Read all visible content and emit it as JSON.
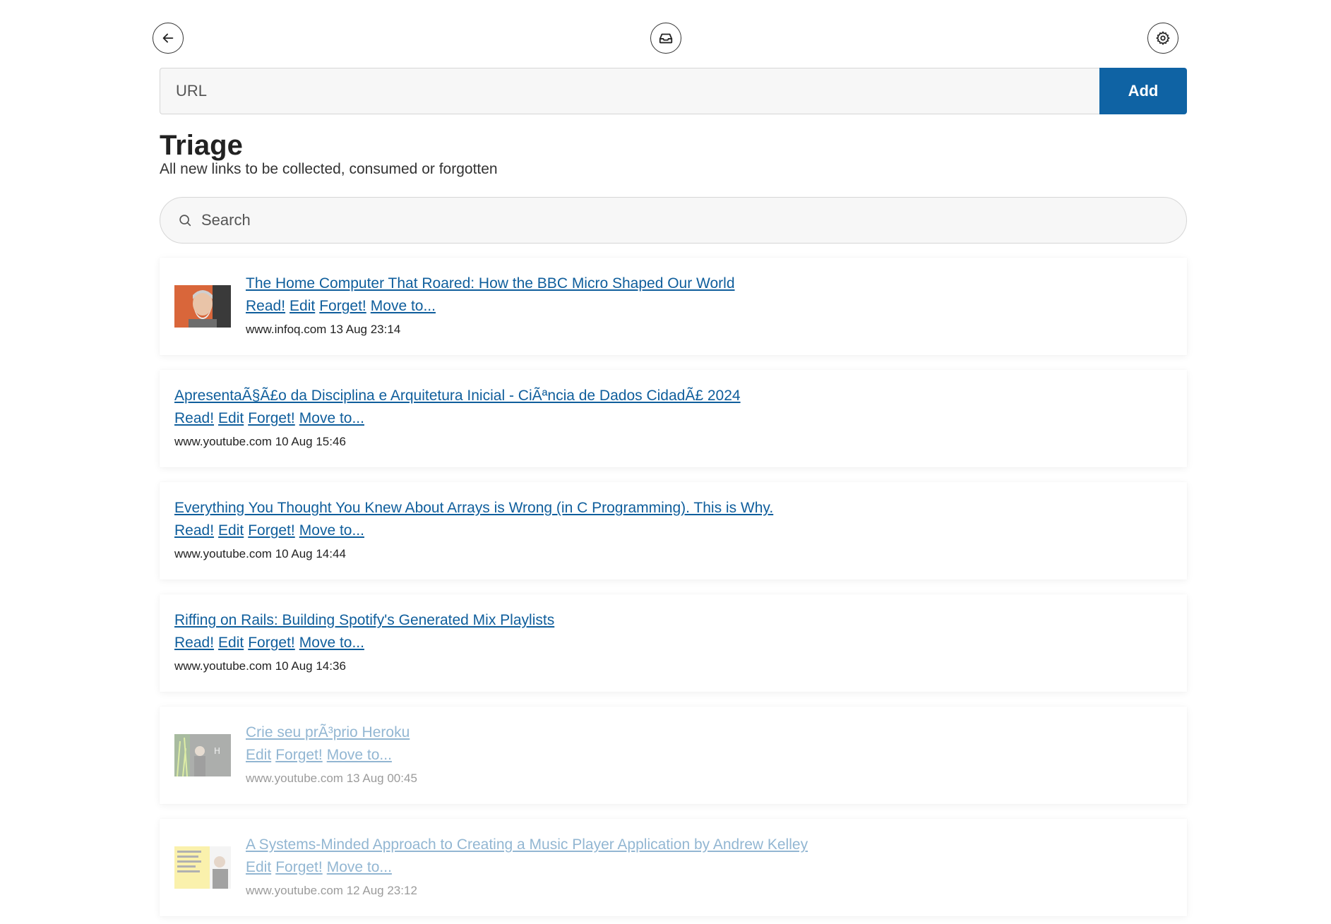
{
  "nav": {
    "back_icon": "arrow-left-icon",
    "inbox_icon": "inbox-icon",
    "settings_icon": "gear-icon"
  },
  "url_form": {
    "placeholder": "URL",
    "add_label": "Add",
    "accent_color": "#0f63a4"
  },
  "page": {
    "title": "Triage",
    "subtitle": "All new links to be collected, consumed or forgotten"
  },
  "search": {
    "placeholder": "Search",
    "icon": "search-icon"
  },
  "links": [
    {
      "title": "The Home Computer That Roared: How the BBC Micro Shaped Our World",
      "actions": [
        "Read!",
        "Edit",
        "Forget!",
        "Move to..."
      ],
      "domain": "www.infoq.com",
      "date": "13 Aug 23:14",
      "has_thumb": true,
      "read": false
    },
    {
      "title": "ApresentaÃ§Ã£o da Disciplina e Arquitetura Inicial - CiÃªncia de Dados CidadÃ£ 2024",
      "actions": [
        "Read!",
        "Edit",
        "Forget!",
        "Move to..."
      ],
      "domain": "www.youtube.com",
      "date": "10 Aug 15:46",
      "has_thumb": false,
      "read": false
    },
    {
      "title": "Everything You Thought You Knew About Arrays is Wrong (in C Programming). This is Why.",
      "actions": [
        "Read!",
        "Edit",
        "Forget!",
        "Move to..."
      ],
      "domain": "www.youtube.com",
      "date": "10 Aug 14:44",
      "has_thumb": false,
      "read": false
    },
    {
      "title": "Riffing on Rails: Building Spotify's Generated Mix Playlists",
      "actions": [
        "Read!",
        "Edit",
        "Forget!",
        "Move to..."
      ],
      "domain": "www.youtube.com",
      "date": "10 Aug 14:36",
      "has_thumb": false,
      "read": false
    },
    {
      "title": "Crie seu prÃ³prio Heroku",
      "actions": [
        "Edit",
        "Forget!",
        "Move to..."
      ],
      "domain": "www.youtube.com",
      "date": "13 Aug 00:45",
      "has_thumb": true,
      "read": true
    },
    {
      "title": "A Systems-Minded Approach to Creating a Music Player Application by Andrew Kelley",
      "actions": [
        "Edit",
        "Forget!",
        "Move to..."
      ],
      "domain": "www.youtube.com",
      "date": "12 Aug 23:12",
      "has_thumb": true,
      "read": true
    }
  ]
}
